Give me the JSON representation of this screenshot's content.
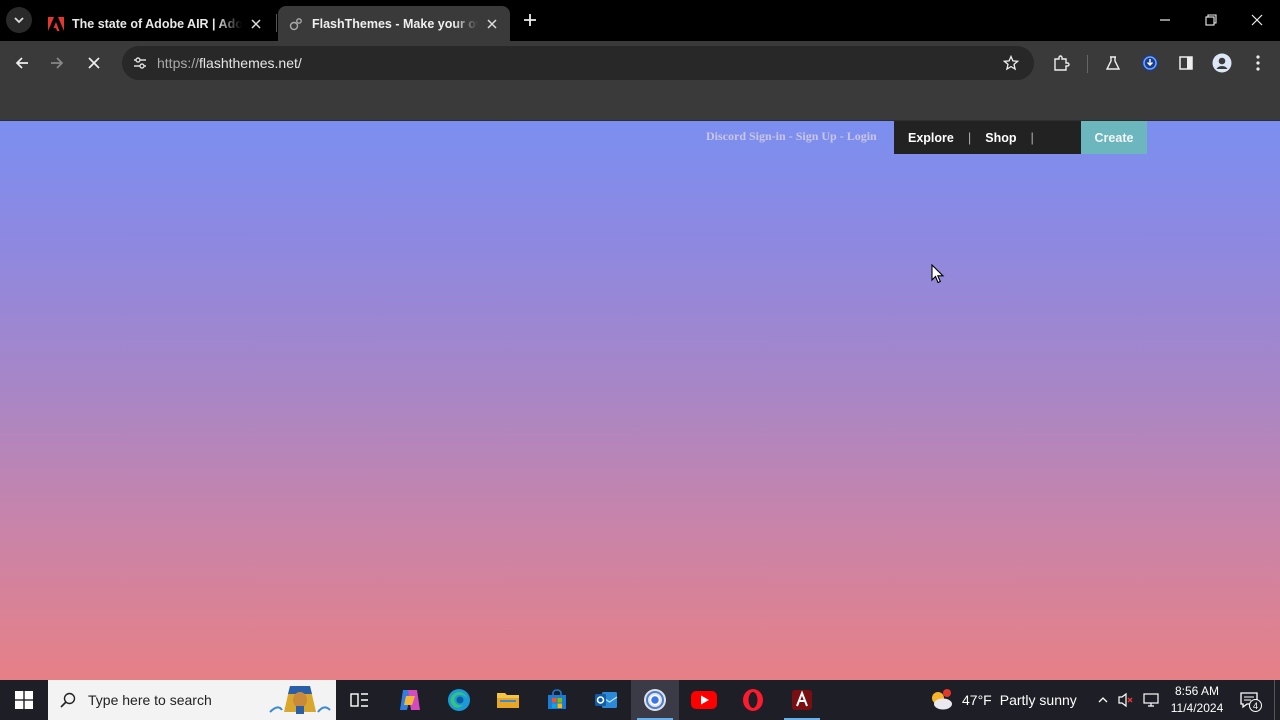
{
  "browser": {
    "tabs": [
      {
        "title": "The state of Adobe AIR | Adob",
        "favicon": "adobe-icon",
        "active": false
      },
      {
        "title": "FlashThemes - Make your own",
        "favicon": "flashthemes-icon",
        "active": true
      }
    ],
    "url_scheme": "https://",
    "url_host": "flashthemes.net/",
    "loading": true
  },
  "page": {
    "auth": {
      "discord": "Discord Sign-in",
      "sep1": " - ",
      "signup": "Sign Up",
      "sep2": " - ",
      "login": "Login"
    },
    "nav": {
      "explore": "Explore",
      "sep": "|",
      "shop": "Shop",
      "sep2": "|",
      "create": "Create"
    },
    "colors": {
      "gradient_top": "#7b8ff0",
      "gradient_bottom": "#e78086",
      "navbar_bg": "#222222",
      "create_bg": "#6cb6bd"
    }
  },
  "taskbar": {
    "search_placeholder": "Type here to search",
    "apps": [
      "task-view-icon",
      "copilot-icon",
      "edge-icon",
      "file-explorer-icon",
      "microsoft-store-icon",
      "outlook-icon",
      "chrome-icon",
      "youtube-icon",
      "opera-icon",
      "adobe-air-icon"
    ],
    "weather": {
      "temp": "47°F",
      "condition": "Partly sunny",
      "alert_count": "1"
    },
    "clock": {
      "time": "8:56 AM",
      "date": "11/4/2024"
    },
    "notifications": "4"
  }
}
